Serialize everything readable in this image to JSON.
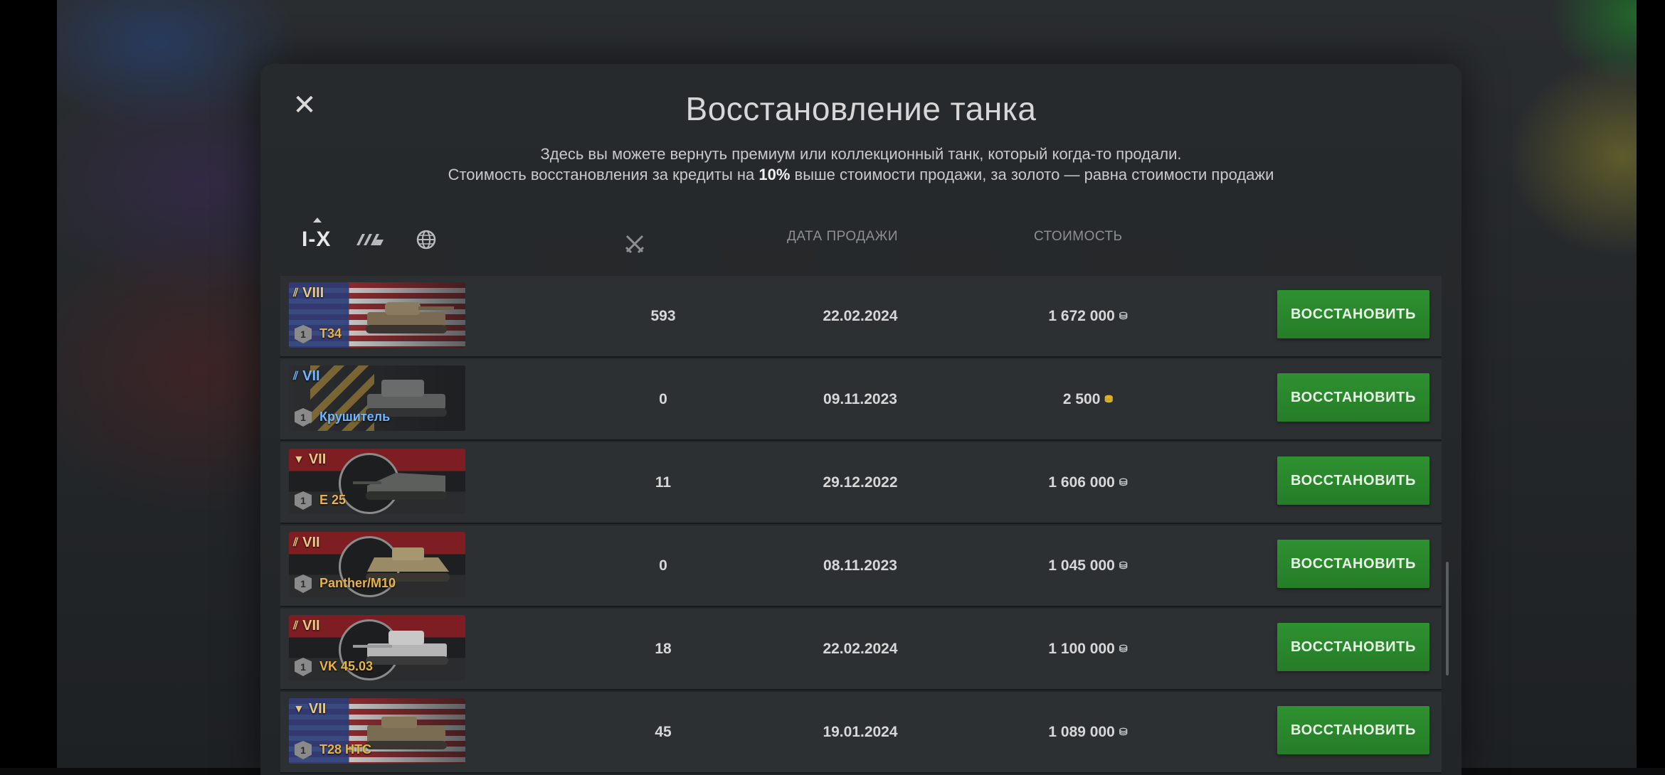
{
  "dialog": {
    "title": "Восстановление танка",
    "subtitle_line1": "Здесь вы можете вернуть премиум или коллекционный танк, который когда-то продали.",
    "subtitle_line2_pre": "Стоимость восстановления за кредиты на ",
    "subtitle_line2_bold": "10%",
    "subtitle_line2_post": " выше стоимости продажи, за золото — равна стоимости продажи",
    "close_icon": "close-icon"
  },
  "filters": {
    "tier_label": "I-X",
    "type_icon": "tank-type-icon",
    "nation_icon": "globe-icon"
  },
  "columns": {
    "battles_icon": "crossed-swords-icon",
    "date": "ДАТА ПРОДАЖИ",
    "cost": "СТОИМОСТЬ"
  },
  "restore_label": "ВОССТАНОВИТЬ",
  "rows": [
    {
      "tier": "VIII",
      "name": "T34",
      "flag": "usa",
      "type": "premium",
      "battles": "593",
      "date": "22.02.2024",
      "cost": "1 672 000",
      "currency": "credit"
    },
    {
      "tier": "VII",
      "name": "Крушитель",
      "flag": "col",
      "type": "collector",
      "battles": "0",
      "date": "09.11.2023",
      "cost": "2 500",
      "currency": "gold"
    },
    {
      "tier": "VII",
      "name": "E 25",
      "flag": "ger",
      "type": "td",
      "battles": "11",
      "date": "29.12.2022",
      "cost": "1 606 000",
      "currency": "credit"
    },
    {
      "tier": "VII",
      "name": "Panther/M10",
      "flag": "ger",
      "type": "premium",
      "battles": "0",
      "date": "08.11.2023",
      "cost": "1 045 000",
      "currency": "credit"
    },
    {
      "tier": "VII",
      "name": "VK 45.03",
      "flag": "ger",
      "type": "premium",
      "battles": "18",
      "date": "22.02.2024",
      "cost": "1 100 000",
      "currency": "credit"
    },
    {
      "tier": "VII",
      "name": "T28 HTC",
      "flag": "usa",
      "type": "td",
      "battles": "45",
      "date": "19.01.2024",
      "cost": "1 089 000",
      "currency": "credit"
    }
  ]
}
